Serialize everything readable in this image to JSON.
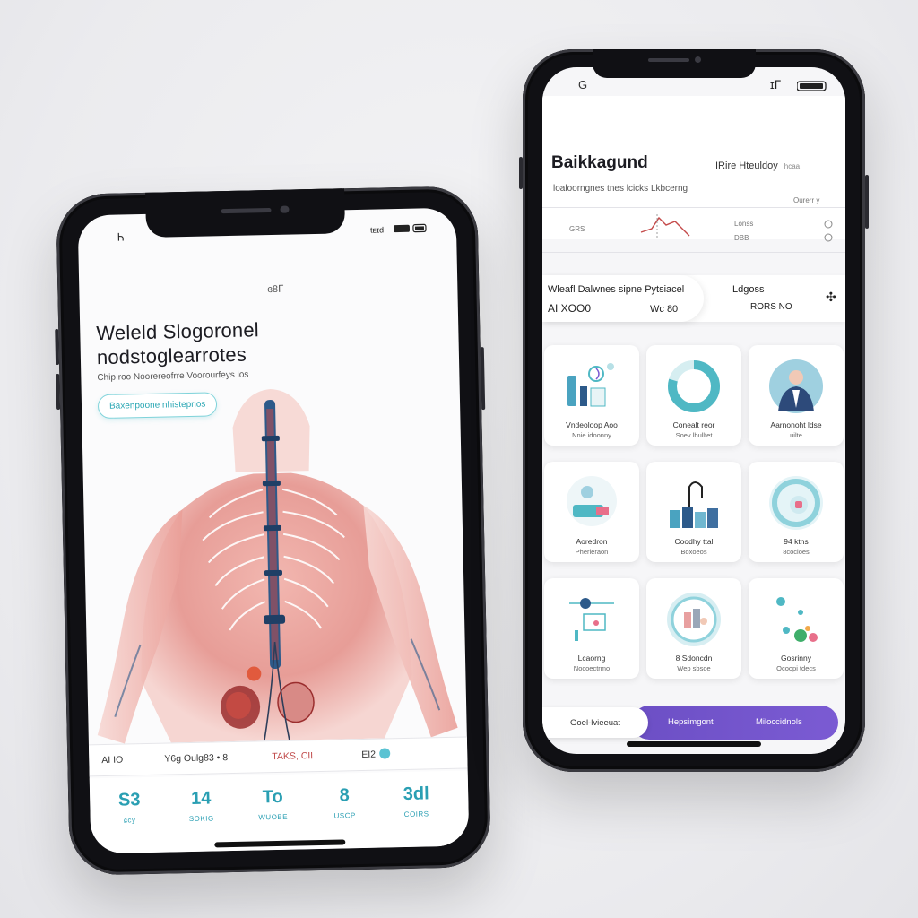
{
  "left_phone": {
    "status_time": "Ꮒ",
    "status_right": "tᴇɪd",
    "scroll_indicator": "ɞ8ᒥ",
    "title_line1": "Weleld Slogoronel",
    "title_line2": "nodstoglearrotes",
    "subtitle": "Chip roo Noorereofrre Voorourfeys los",
    "tag": "Baxenpoone nhisteprios",
    "footer_row": [
      "AI IO",
      "Y6g Oulg83 • 8",
      "TAKS, CII",
      "EI2"
    ],
    "stats": [
      {
        "value": "S3",
        "label": "ɕcy"
      },
      {
        "value": "14",
        "label": "SOKIG"
      },
      {
        "value": "To",
        "label": "WUOBE"
      },
      {
        "value": "8",
        "label": "USCP"
      },
      {
        "value": "3dl",
        "label": "COIRS"
      }
    ],
    "colors": {
      "accent": "#2a9fb3",
      "body": "#e8a0a0",
      "spine": "#2d5a8a"
    }
  },
  "right_phone": {
    "status_left": "G",
    "status_right": "ɪᒥ",
    "title": "Baikkagund",
    "title_right": "IRire Hteuldoy",
    "title_right_small": "hcaa",
    "subtitle": "loaloorngnes tnes lcicks Lkbcerng",
    "small_right": "Ourerr y",
    "row_left": "GRS",
    "row_right_1": "Lonss",
    "row_right_2": "DBB",
    "banner_left_1": "Wleafl Dalwnes sipne Pytsiacel",
    "banner_left_2": "AI XOO0",
    "banner_mid": "Wc 80",
    "banner_right_1": "Ldgoss",
    "banner_right_2": "RORS NO",
    "cards": [
      {
        "cap1": "Vndeoloop Aoo",
        "cap2": "Nnie idoonny",
        "icon": "lab-icon"
      },
      {
        "cap1": "Conealt reor",
        "cap2": "Soev lbulltet",
        "icon": "ring-chart-icon"
      },
      {
        "cap1": "Aarnonoht ldse",
        "cap2": "uilte",
        "icon": "doctor-icon"
      },
      {
        "cap1": "Aoredron",
        "cap2": "Pherleraon",
        "icon": "patient-icon"
      },
      {
        "cap1": "Coodhy ttal",
        "cap2": "Boxoeos",
        "icon": "stethoscope-icon"
      },
      {
        "cap1": "94 ktns",
        "cap2": "8cocioes",
        "icon": "scan-icon"
      },
      {
        "cap1": "Lcaorng",
        "cap2": "Nocoectrmo",
        "icon": "microscope-icon"
      },
      {
        "cap1": "8 Sdoncdn",
        "cap2": "Wep sbsoe",
        "icon": "bottle-icon"
      },
      {
        "cap1": "Gosrinny",
        "cap2": "Ocoopi tdecs",
        "icon": "molecule-icon"
      }
    ],
    "bottom_left": "Goel-lvieeuat",
    "bottom_mid": "Hepsimgont",
    "bottom_right": "Miloccidnols",
    "colors": {
      "accent": "#6c4fc5",
      "teal": "#4fb8c4"
    }
  }
}
